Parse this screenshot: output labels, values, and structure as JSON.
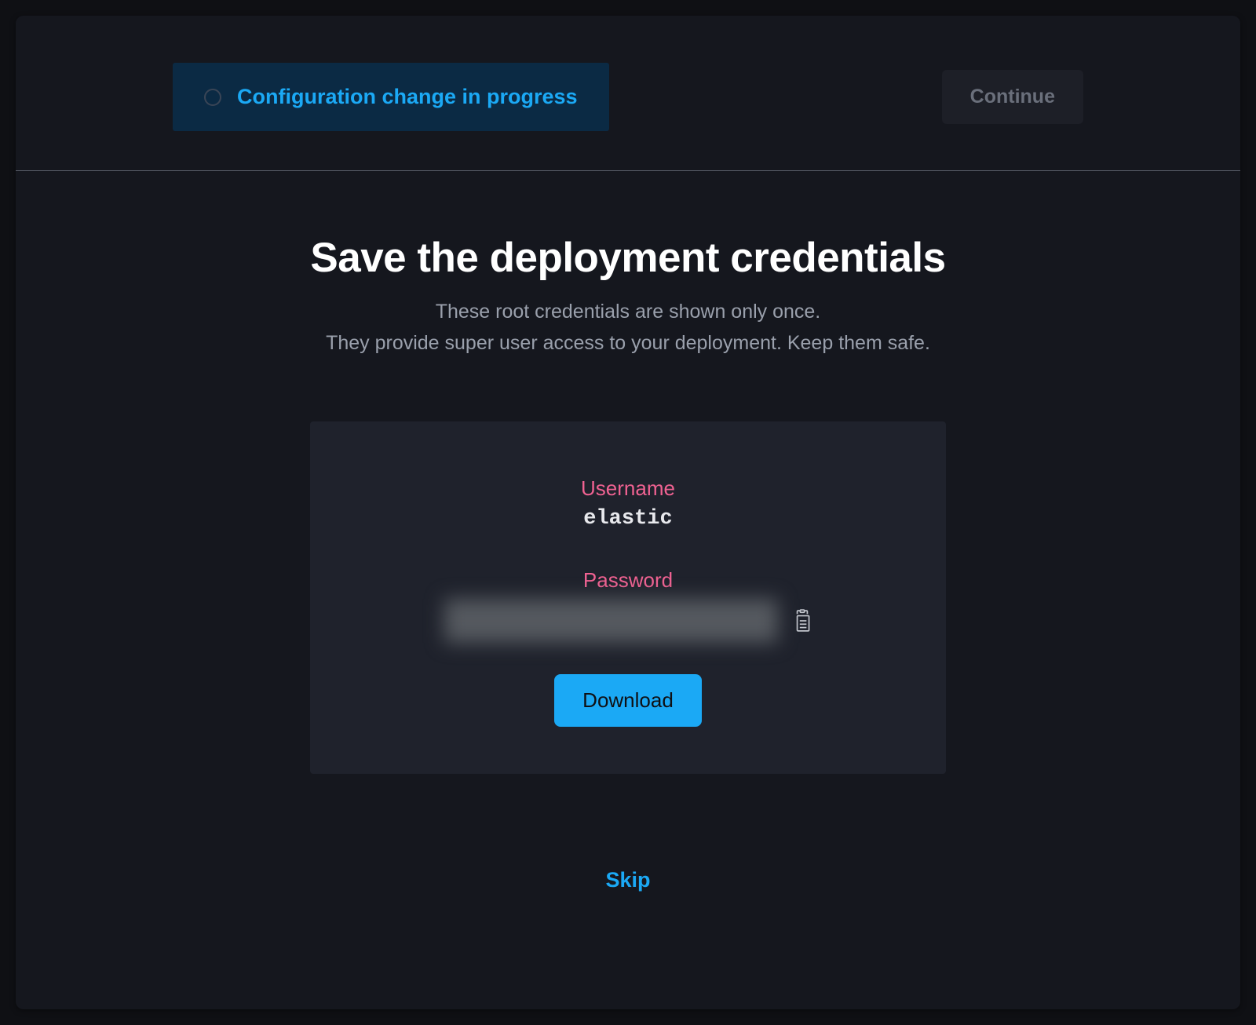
{
  "header": {
    "status_text": "Configuration change in progress",
    "continue_label": "Continue"
  },
  "main": {
    "title": "Save the deployment credentials",
    "subtitle_line1": "These root credentials are shown only once.",
    "subtitle_line2": "They provide super user access to your deployment. Keep them safe."
  },
  "credentials": {
    "username_label": "Username",
    "username_value": "elastic",
    "password_label": "Password",
    "download_label": "Download"
  },
  "footer": {
    "skip_label": "Skip"
  }
}
